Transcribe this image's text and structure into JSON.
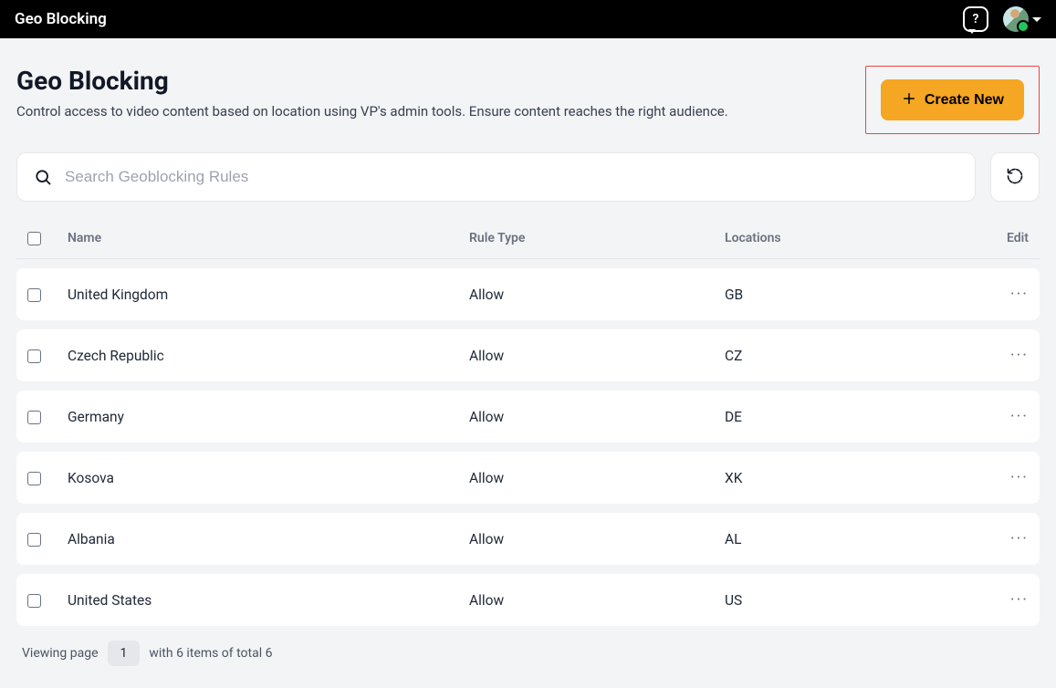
{
  "topbar": {
    "title": "Geo Blocking"
  },
  "header": {
    "title": "Geo Blocking",
    "description": "Control access to video content based on location using VP's admin tools. Ensure content reaches the right audience.",
    "create_label": "Create New"
  },
  "search": {
    "placeholder": "Search Geoblocking Rules"
  },
  "table": {
    "columns": {
      "name": "Name",
      "rule_type": "Rule Type",
      "locations": "Locations",
      "edit": "Edit"
    },
    "rows": [
      {
        "name": "United Kingdom",
        "rule_type": "Allow",
        "locations": "GB"
      },
      {
        "name": "Czech Republic",
        "rule_type": "Allow",
        "locations": "CZ"
      },
      {
        "name": "Germany",
        "rule_type": "Allow",
        "locations": "DE"
      },
      {
        "name": "Kosova",
        "rule_type": "Allow",
        "locations": "XK"
      },
      {
        "name": "Albania",
        "rule_type": "Allow",
        "locations": "AL"
      },
      {
        "name": "United States",
        "rule_type": "Allow",
        "locations": "US"
      }
    ]
  },
  "footer": {
    "viewing_label": "Viewing page",
    "page_number": "1",
    "items_label": "with 6 items of total 6"
  }
}
